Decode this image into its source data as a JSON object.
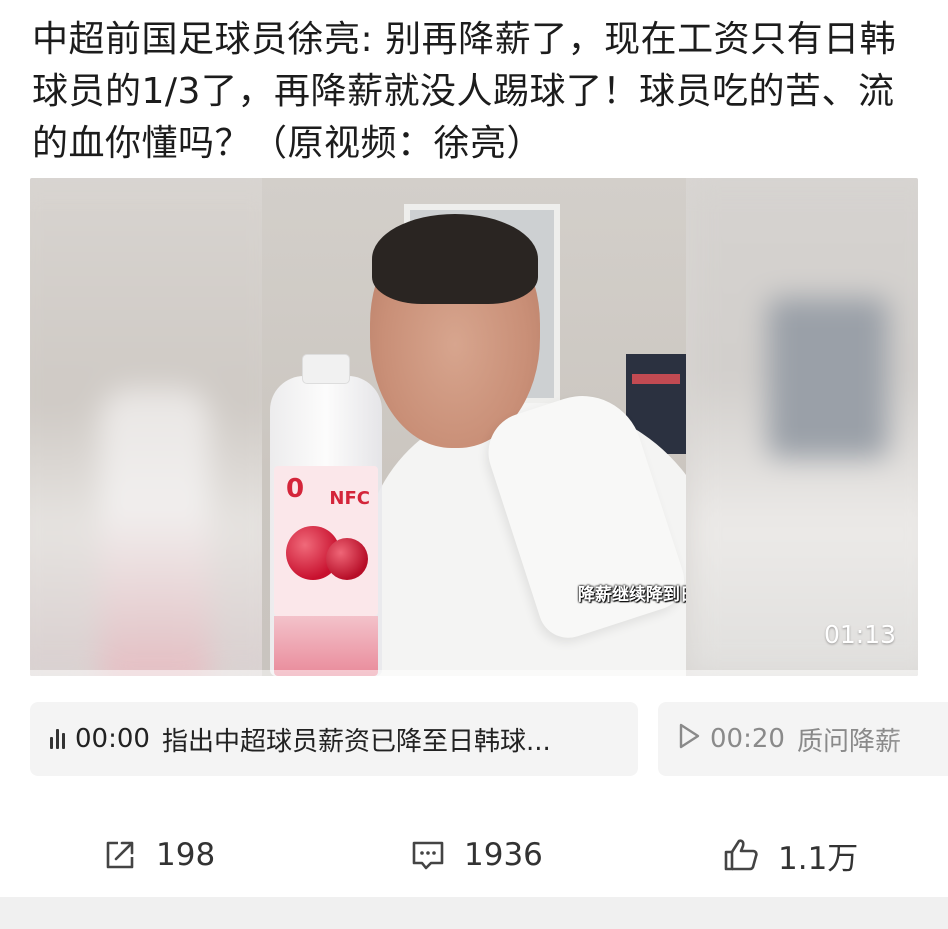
{
  "post": {
    "title": "中超前国足球员徐亮: 别再降薪了，现在工资只有日韩球员的1/3了，再降薪就没人踢球了！球员吃的苦、流的血你懂吗？（原视频：徐亮）"
  },
  "video": {
    "subtitle": "降薪继续降到日韩球员的收入",
    "duration": "01:13",
    "bottle_zero": "0",
    "bottle_brand": "NFC"
  },
  "chapters": [
    {
      "time": "00:00",
      "text": "指出中超球员薪资已降至日韩球...",
      "icon": "bars-icon"
    },
    {
      "time": "00:20",
      "text": "质问降薪",
      "icon": "play-icon"
    }
  ],
  "actions": {
    "share_count": "198",
    "comment_count": "1936",
    "like_count": "1.1万"
  }
}
